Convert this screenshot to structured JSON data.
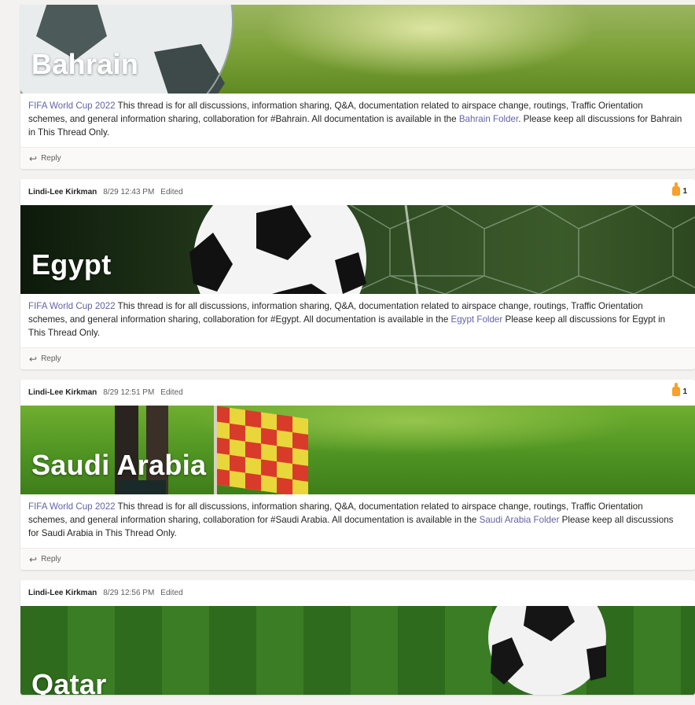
{
  "posts": [
    {
      "banner_title": "Bahrain",
      "body_link": "FIFA World Cup 2022",
      "body_text": " This thread is for all discussions, information sharing, Q&A, documentation related to airspace change, routings, Traffic Orientation schemes, and general information sharing, collaboration for #Bahrain. All documentation is available in the ",
      "folder_link": "Bahrain Folder",
      "body_tail": ". Please keep all discussions for Bahrain in This Thread Only.",
      "reply_label": "Reply"
    },
    {
      "author": "Lindi-Lee Kirkman",
      "timestamp": "8/29 12:43 PM",
      "edited": "Edited",
      "reaction_count": "1",
      "banner_title": "Egypt",
      "body_link": "FIFA World Cup 2022",
      "body_text": " This thread is for all discussions, information sharing, Q&A, documentation related to airspace change, routings, Traffic Orientation schemes, and general information sharing, collaboration for #Egypt. All documentation is available in the ",
      "folder_link": "Egypt Folder",
      "body_tail": "  Please keep all discussions for Egypt in This Thread Only.",
      "reply_label": "Reply"
    },
    {
      "author": "Lindi-Lee Kirkman",
      "timestamp": "8/29 12:51 PM",
      "edited": "Edited",
      "reaction_count": "1",
      "banner_title": "Saudi Arabia",
      "body_link": "FIFA World Cup 2022",
      "body_text": " This thread is for all discussions, information sharing, Q&A, documentation related to airspace change, routings, Traffic Orientation schemes, and general information sharing, collaboration for #Saudi Arabia. All documentation is available in the ",
      "folder_link": "Saudi Arabia Folder",
      "body_tail": " Please keep all discussions for Saudi Arabia in This Thread Only.",
      "reply_label": "Reply"
    },
    {
      "author": "Lindi-Lee Kirkman",
      "timestamp": "8/29 12:56 PM",
      "edited": "Edited",
      "banner_title": "Qatar"
    }
  ],
  "colors": {
    "link": "#6264a7",
    "reaction": "#f7a12a",
    "background": "#f3f2f1"
  },
  "icons": {
    "reply": "reply-arrow-icon",
    "reaction": "thumbs-up-icon"
  }
}
